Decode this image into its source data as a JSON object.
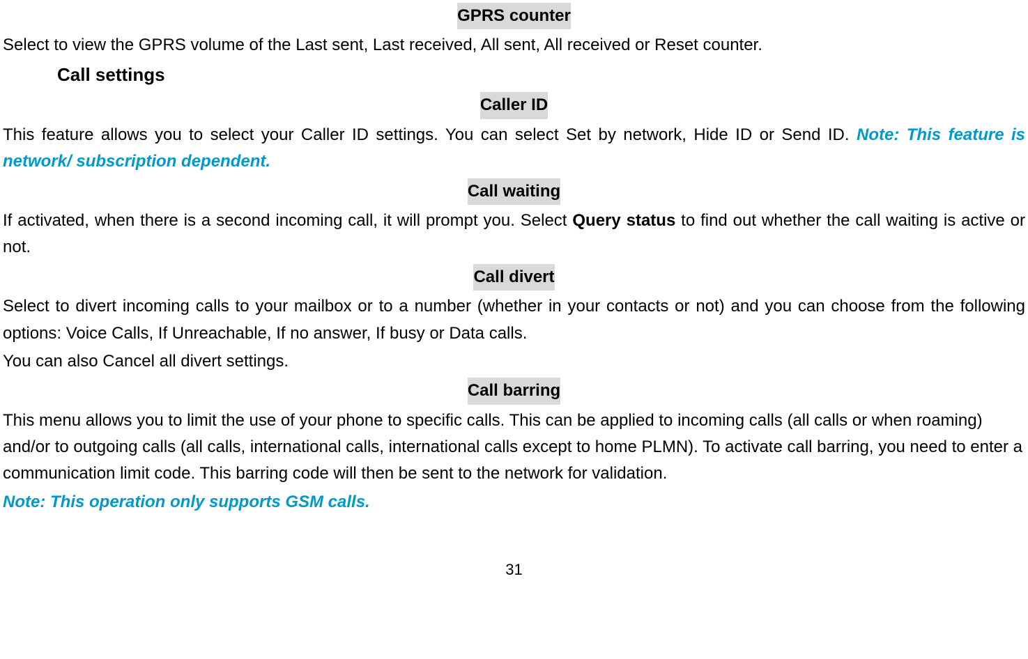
{
  "headings": {
    "gprs_counter": "GPRS counter",
    "call_settings": "Call settings",
    "caller_id": "Caller ID",
    "call_waiting": "Call waiting",
    "call_divert": "Call divert",
    "call_barring": "Call barring"
  },
  "body": {
    "gprs_counter_text": "Select to view the GPRS volume of the Last sent, Last received, All sent, All received or Reset counter.",
    "caller_id_text_1": "This feature allows you to select your Caller ID settings. You can select Set by network, Hide ID or Send ID. ",
    "caller_id_note": "Note: This feature is network/ subscription dependent.",
    "call_waiting_text_1": "If activated, when there is a second incoming call, it will prompt you. Select ",
    "call_waiting_bold": "Query status",
    "call_waiting_text_2": " to find out whether the call waiting is active or not.",
    "call_divert_text_1": "Select to divert incoming calls to your mailbox or to a number (whether in your contacts or not) and you can choose from the following options: Voice Calls, If Unreachable, If no answer, If busy or Data calls.",
    "call_divert_text_2": "You can also Cancel all divert settings.",
    "call_barring_text": "This menu allows you to limit the use of your phone to specific calls. This can be applied to incoming calls (all calls or when roaming) and/or to outgoing calls (all calls, international calls, international calls except to home PLMN). To activate call barring, you need to enter a communication limit code. This barring code will then be sent to the network for validation.",
    "call_barring_note": "Note: This operation only supports GSM calls."
  },
  "page_number": "31"
}
